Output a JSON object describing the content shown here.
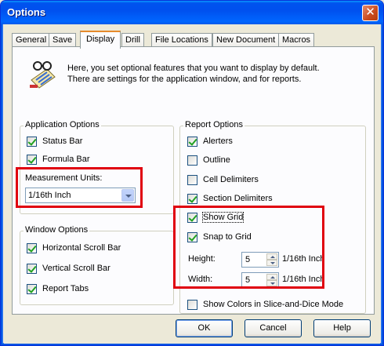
{
  "window": {
    "title": "Options"
  },
  "tabs": [
    "General",
    "Save",
    "Display",
    "Drill",
    "File Locations",
    "New Document",
    "Macros"
  ],
  "active_tab": "Display",
  "intro": {
    "line1": "Here, you set optional features that you want to display by default.",
    "line2": "There are settings for the application window, and for reports."
  },
  "application_options": {
    "title": "Application Options",
    "status_bar": {
      "label": "Status Bar",
      "checked": true
    },
    "formula_bar": {
      "label": "Formula Bar",
      "checked": true
    },
    "measurement_units_label": "Measurement Units:",
    "measurement_units_value": "1/16th Inch"
  },
  "window_options": {
    "title": "Window Options",
    "horizontal_scroll_bar": {
      "label": "Horizontal Scroll Bar",
      "checked": true
    },
    "vertical_scroll_bar": {
      "label": "Vertical Scroll Bar",
      "checked": true
    },
    "report_tabs": {
      "label": "Report Tabs",
      "checked": true
    }
  },
  "report_options": {
    "title": "Report Options",
    "alerters": {
      "label": "Alerters",
      "checked": true
    },
    "outline": {
      "label": "Outline",
      "checked": false
    },
    "cell_delimiters": {
      "label": "Cell Delimiters",
      "checked": false
    },
    "section_delimiters": {
      "label": "Section Delimiters",
      "checked": true
    },
    "show_grid": {
      "label": "Show Grid",
      "checked": true
    },
    "snap_to_grid": {
      "label": "Snap to Grid",
      "checked": true
    },
    "height_label": "Height:",
    "height_value": "5",
    "width_label": "Width:",
    "width_value": "5",
    "unit": "1/16th Inch",
    "show_colors": {
      "label": "Show Colors in Slice-and-Dice Mode",
      "checked": false
    }
  },
  "buttons": {
    "ok": "OK",
    "cancel": "Cancel",
    "help": "Help"
  },
  "colors": {
    "highlight_box": "#e0000f",
    "titlebar": "#0054e3"
  }
}
